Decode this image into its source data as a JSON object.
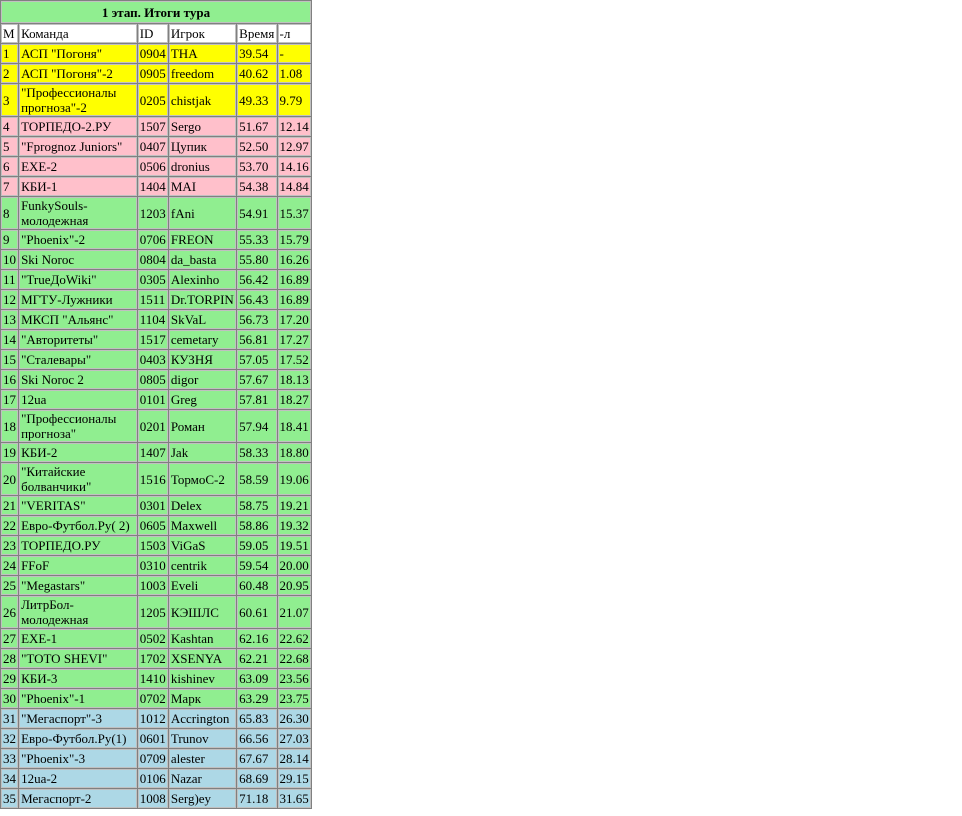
{
  "title": "1 этап. Итоги тура",
  "headers": [
    "М",
    "Команда",
    "ID",
    "Игрок",
    "Время",
    "-л"
  ],
  "colors": {
    "yellow": "#ffff00",
    "pink": "#ffc0cb",
    "green": "#90ee90",
    "blue": "#add8e6"
  },
  "rows": [
    {
      "place": "1",
      "team": "АСП \"Погоня\"",
      "id": "0904",
      "player": "THA",
      "time": "39.54",
      "diff": "-",
      "zone": "yellow"
    },
    {
      "place": "2",
      "team": "АСП \"Погоня\"-2",
      "id": "0905",
      "player": "freedom",
      "time": "40.62",
      "diff": "1.08",
      "zone": "yellow"
    },
    {
      "place": "3",
      "team": "\"Профессионалы прогноза\"-2",
      "id": "0205",
      "player": "chistjak",
      "time": "49.33",
      "diff": "9.79",
      "zone": "yellow"
    },
    {
      "place": "4",
      "team": "ТОРПЕДО-2.РУ",
      "id": "1507",
      "player": "Sergo",
      "time": "51.67",
      "diff": "12.14",
      "zone": "pink"
    },
    {
      "place": "5",
      "team": "\"Fprognoz Juniors\"",
      "id": "0407",
      "player": "Цупик",
      "time": "52.50",
      "diff": "12.97",
      "zone": "pink"
    },
    {
      "place": "6",
      "team": "EXE-2",
      "id": "0506",
      "player": "dronius",
      "time": "53.70",
      "diff": "14.16",
      "zone": "pink"
    },
    {
      "place": "7",
      "team": "КБИ-1",
      "id": "1404",
      "player": "MAI",
      "time": "54.38",
      "diff": "14.84",
      "zone": "pink"
    },
    {
      "place": "8",
      "team": "FunkySouls-молодежная",
      "id": "1203",
      "player": "fAni",
      "time": "54.91",
      "diff": "15.37",
      "zone": "green"
    },
    {
      "place": "9",
      "team": "\"Phoenix\"-2",
      "id": "0706",
      "player": "FREON",
      "time": "55.33",
      "diff": "15.79",
      "zone": "green"
    },
    {
      "place": "10",
      "team": "Ski Noroc",
      "id": "0804",
      "player": "da_basta",
      "time": "55.80",
      "diff": "16.26",
      "zone": "green"
    },
    {
      "place": "11",
      "team": "\"TrueДоWiki\"",
      "id": "0305",
      "player": "Alexinho",
      "time": "56.42",
      "diff": "16.89",
      "zone": "green"
    },
    {
      "place": "12",
      "team": "МГТУ-Лужники",
      "id": "1511",
      "player": "Dr.TORPIN",
      "time": "56.43",
      "diff": "16.89",
      "zone": "green"
    },
    {
      "place": "13",
      "team": "МКСП \"Альянс\"",
      "id": "1104",
      "player": "SkVaL",
      "time": "56.73",
      "diff": "17.20",
      "zone": "green"
    },
    {
      "place": "14",
      "team": "\"Авторитеты\"",
      "id": "1517",
      "player": "cemetary",
      "time": "56.81",
      "diff": "17.27",
      "zone": "green"
    },
    {
      "place": "15",
      "team": "\"Сталевары\"",
      "id": "0403",
      "player": "КУЗНЯ",
      "time": "57.05",
      "diff": "17.52",
      "zone": "green"
    },
    {
      "place": "16",
      "team": "Ski Noroc 2",
      "id": "0805",
      "player": "digor",
      "time": "57.67",
      "diff": "18.13",
      "zone": "green"
    },
    {
      "place": "17",
      "team": "12ua",
      "id": "0101",
      "player": "Greg",
      "time": "57.81",
      "diff": "18.27",
      "zone": "green"
    },
    {
      "place": "18",
      "team": "\"Профессионалы прогноза\"",
      "id": "0201",
      "player": "Роман",
      "time": "57.94",
      "diff": "18.41",
      "zone": "green"
    },
    {
      "place": "19",
      "team": "КБИ-2",
      "id": "1407",
      "player": "Jak",
      "time": "58.33",
      "diff": "18.80",
      "zone": "green"
    },
    {
      "place": "20",
      "team": "\"Китайские болванчики\"",
      "id": "1516",
      "player": "ТормоС-2",
      "time": "58.59",
      "diff": "19.06",
      "zone": "green"
    },
    {
      "place": "21",
      "team": "\"VERITAS\"",
      "id": "0301",
      "player": "Delex",
      "time": "58.75",
      "diff": "19.21",
      "zone": "green"
    },
    {
      "place": "22",
      "team": "Евро-Футбол.Ру( 2)",
      "id": "0605",
      "player": "Maxwell",
      "time": "58.86",
      "diff": "19.32",
      "zone": "green"
    },
    {
      "place": "23",
      "team": "ТОРПЕДО.РУ",
      "id": "1503",
      "player": "ViGaS",
      "time": "59.05",
      "diff": "19.51",
      "zone": "green"
    },
    {
      "place": "24",
      "team": "FFoF",
      "id": "0310",
      "player": "centrik",
      "time": "59.54",
      "diff": "20.00",
      "zone": "green"
    },
    {
      "place": "25",
      "team": "\"Megastars\"",
      "id": "1003",
      "player": "Eveli",
      "time": "60.48",
      "diff": "20.95",
      "zone": "green"
    },
    {
      "place": "26",
      "team": "ЛитрБол-молодежная",
      "id": "1205",
      "player": "КЭШЛС",
      "time": "60.61",
      "diff": "21.07",
      "zone": "green"
    },
    {
      "place": "27",
      "team": "EXE-1",
      "id": "0502",
      "player": "Kashtan",
      "time": "62.16",
      "diff": "22.62",
      "zone": "green"
    },
    {
      "place": "28",
      "team": "\"TOTO SHEVI\"",
      "id": "1702",
      "player": "XSENYA",
      "time": "62.21",
      "diff": "22.68",
      "zone": "green"
    },
    {
      "place": "29",
      "team": "КБИ-3",
      "id": "1410",
      "player": "kishinev",
      "time": "63.09",
      "diff": "23.56",
      "zone": "green"
    },
    {
      "place": "30",
      "team": "\"Phoenix\"-1",
      "id": "0702",
      "player": "Марк",
      "time": "63.29",
      "diff": "23.75",
      "zone": "green"
    },
    {
      "place": "31",
      "team": "\"Мегаспорт\"-3",
      "id": "1012",
      "player": "Accrington",
      "time": "65.83",
      "diff": "26.30",
      "zone": "blue"
    },
    {
      "place": "32",
      "team": "Евро-Футбол.Ру(1)",
      "id": "0601",
      "player": "Trunov",
      "time": "66.56",
      "diff": "27.03",
      "zone": "blue"
    },
    {
      "place": "33",
      "team": "\"Phoenix\"-3",
      "id": "0709",
      "player": "alester",
      "time": "67.67",
      "diff": "28.14",
      "zone": "blue"
    },
    {
      "place": "34",
      "team": "12ua-2",
      "id": "0106",
      "player": "Nazar",
      "time": "68.69",
      "diff": "29.15",
      "zone": "blue"
    },
    {
      "place": "35",
      "team": "Мегаспорт-2",
      "id": "1008",
      "player": "Serg)ey",
      "time": "71.18",
      "diff": "31.65",
      "zone": "blue"
    }
  ]
}
